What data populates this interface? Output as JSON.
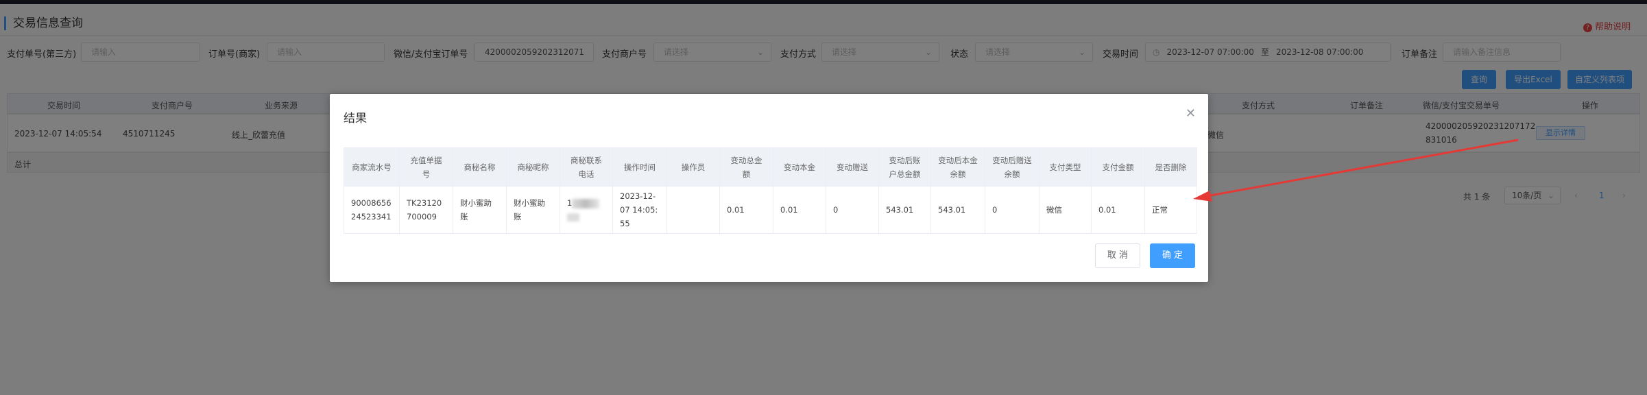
{
  "page": {
    "title": "交易信息查询",
    "help": "帮助说明"
  },
  "filters": [
    {
      "label": "支付单号(第三方)",
      "value": "",
      "placeholder": "请输入"
    },
    {
      "label": "订单号(商家)",
      "value": "",
      "placeholder": "请输入"
    },
    {
      "label": "微信/支付宝订单号",
      "value": "4200002059202312071",
      "placeholder": ""
    },
    {
      "label": "支付商户号",
      "value": "",
      "placeholder": "请选择"
    },
    {
      "label": "支付方式",
      "value": "",
      "placeholder": "请选择"
    },
    {
      "label": "状态",
      "value": "",
      "placeholder": "请选择"
    },
    {
      "label": "交易时间",
      "start": "2023-12-07 07:00:00",
      "sep": "至",
      "end": "2023-12-08 07:00:00"
    },
    {
      "label": "订单备注",
      "value": "",
      "placeholder": "请输入备注信息"
    }
  ],
  "actions": {
    "query": "查询",
    "export": "导出Excel",
    "columns": "自定义列表项"
  },
  "grid": {
    "headers": [
      "交易时间",
      "支付商户号",
      "业务来源",
      "支付方式",
      "订单备注",
      "微信/支付宝交易单号",
      "操作"
    ],
    "row": {
      "time": "2023-12-07 14:05:54",
      "merchant": "4510711245",
      "source": "线上_欣蕾充值",
      "pay": "微信",
      "txn_line1": "420000205920231207172",
      "txn_line2": "831016",
      "action": "显示详情"
    },
    "sum_label": "总计"
  },
  "pager": {
    "total": "共 1 条",
    "size": "10条/页",
    "current": "1"
  },
  "dialog": {
    "title": "结果",
    "headers": [
      "商家流水号",
      "充值单据号",
      "商秘名称",
      "商秘昵称",
      "商秘联系电话",
      "操作时间",
      "操作员",
      "变动总金额",
      "变动本金",
      "变动赠送",
      "变动后账户总金额",
      "变动后本金余额",
      "变动后赠送余额",
      "支付类型",
      "支付金额",
      "是否删除"
    ],
    "row": [
      "9000865624523341",
      "TK23120700009",
      "财小蜜助账",
      "财小蜜助账",
      "1",
      "2023-12-07 14:05:55",
      "",
      "0.01",
      "0.01",
      "0",
      "543.01",
      "543.01",
      "0",
      "微信",
      "0.01",
      "正常"
    ],
    "cancel": "取 消",
    "confirm": "确 定"
  },
  "colors": {
    "accent": "#409eff",
    "annotation": "#e53935"
  }
}
